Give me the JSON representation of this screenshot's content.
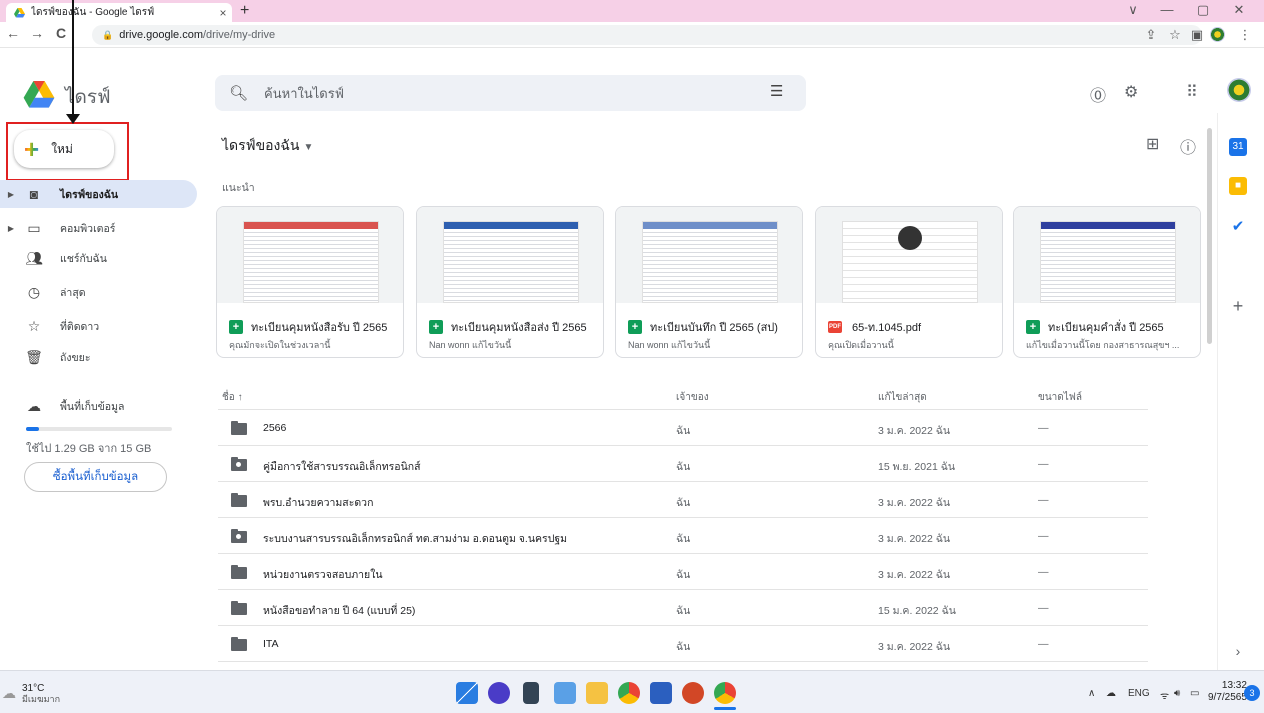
{
  "browser": {
    "tab_title": "ไดรฟ์ของฉัน - Google ไดรฟ์",
    "tab_close": "×",
    "new_tab": "+",
    "url_domain": "drive.google.com",
    "url_path": "/drive/my-drive",
    "back": "←",
    "forward": "→",
    "reload": "C",
    "minimize": "—",
    "restore": "▢",
    "close": "✕",
    "dropdown": "∨"
  },
  "header": {
    "brand": "ไดรฟ์",
    "search_placeholder": "ค้นหาในไดรฟ์"
  },
  "sidebar": {
    "new_label": "ใหม่",
    "items": [
      {
        "label": "ไดรฟ์ของฉัน",
        "icon": "my-drive-icon"
      },
      {
        "label": "คอมพิวเตอร์",
        "icon": "computer-icon"
      },
      {
        "label": "แชร์กับฉัน",
        "icon": "shared-icon"
      },
      {
        "label": "ล่าสุด",
        "icon": "clock-icon"
      },
      {
        "label": "ที่ติดดาว",
        "icon": "star-icon"
      },
      {
        "label": "ถังขยะ",
        "icon": "trash-icon"
      },
      {
        "label": "พื้นที่เก็บข้อมูล",
        "icon": "cloud-icon"
      }
    ],
    "storage_text": "ใช้ไป 1.29 GB จาก 15 GB",
    "storage_fraction": 0.086,
    "buy_storage": "ซื้อพื้นที่เก็บข้อมูล"
  },
  "main": {
    "title": "ไดรฟ์ของฉัน",
    "suggested_label": "แนะนำ",
    "cards": [
      {
        "name": "ทะเบียนคุมหนังสือรับ ปี 2565",
        "sub": "คุณมักจะเปิดในช่วงเวลานี้",
        "type": "sheet",
        "band": "#d9534f"
      },
      {
        "name": "ทะเบียนคุมหนังสือส่ง ปี 2565",
        "sub": "Nan wonn แก้ไขวันนี้",
        "type": "sheet",
        "band": "#2e5fb0"
      },
      {
        "name": "ทะเบียนบันทึก ปี 2565 (สป)",
        "sub": "Nan wonn แก้ไขวันนี้",
        "type": "sheet",
        "band": "#6f8fc9"
      },
      {
        "name": "65-ท.1045.pdf",
        "sub": "คุณเปิดเมื่อวานนี้",
        "type": "pdf",
        "band": "#ffffff"
      },
      {
        "name": "ทะเบียนคุมคำสั่ง ปี 2565",
        "sub": "แก้ไขเมื่อวานนี้โดย กองสาธารณสุขฯ ...",
        "type": "sheet",
        "band": "#2f3f9e"
      }
    ],
    "columns": {
      "name": "ชื่อ ↑",
      "owner": "เจ้าของ",
      "modified": "แก้ไขล่าสุด",
      "size": "ขนาดไฟล์"
    },
    "files": [
      {
        "name": "2566",
        "owner": "ฉัน",
        "modified": "3 ม.ค. 2022 ฉัน",
        "size": "—",
        "shared": false
      },
      {
        "name": "คู่มือการใช้สารบรรณอิเล็กทรอนิกส์",
        "owner": "ฉัน",
        "modified": "15 พ.ย. 2021 ฉัน",
        "size": "—",
        "shared": true
      },
      {
        "name": "พรบ.อำนวยความสะดวก",
        "owner": "ฉัน",
        "modified": "3 ม.ค. 2022 ฉัน",
        "size": "—",
        "shared": false
      },
      {
        "name": "ระบบงานสารบรรณอิเล็กทรอนิกส์ ทต.สามง่าม อ.ดอนตูม จ.นครปฐม",
        "owner": "ฉัน",
        "modified": "3 ม.ค. 2022 ฉัน",
        "size": "—",
        "shared": true
      },
      {
        "name": "หน่วยงานตรวจสอบภายใน",
        "owner": "ฉัน",
        "modified": "3 ม.ค. 2022 ฉัน",
        "size": "—",
        "shared": false
      },
      {
        "name": "หนังสือขอทำลาย ปี 64 (แบบที่ 25)",
        "owner": "ฉัน",
        "modified": "15 ม.ค. 2022 ฉัน",
        "size": "—",
        "shared": false
      },
      {
        "name": "ITA",
        "owner": "ฉัน",
        "modified": "3 ม.ค. 2022 ฉัน",
        "size": "—",
        "shared": false
      }
    ]
  },
  "taskbar": {
    "temp": "31°C",
    "weather": "มีเมฆมาก",
    "lang": "ENG",
    "time": "13:32",
    "date": "9/7/2565",
    "notifications": "3"
  },
  "colors": {
    "accent": "#1a73e8",
    "active_nav": "#dde6f7",
    "annotation": "#e02020"
  }
}
